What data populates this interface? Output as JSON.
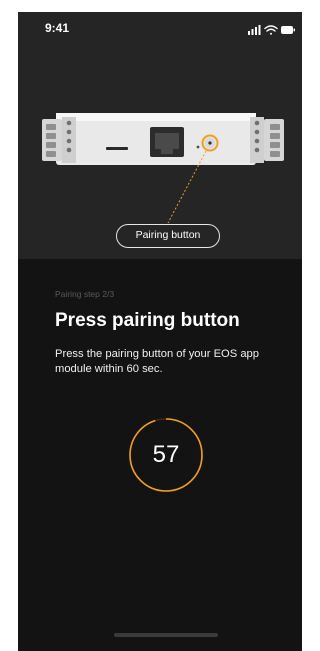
{
  "status_bar": {
    "time": "9:41",
    "icons": [
      "signal-icon",
      "wifi-icon",
      "battery-icon"
    ]
  },
  "hero": {
    "pairing_label": "Pairing button",
    "highlight_color": "#f0a020"
  },
  "content": {
    "step": "Pairing step 2/3",
    "title": "Press pairing button",
    "description": "Press the pairing button of your EOS app module within 60 sec."
  },
  "timer": {
    "value": "57",
    "accent_color": "#f0a020",
    "progress": 0.95
  }
}
